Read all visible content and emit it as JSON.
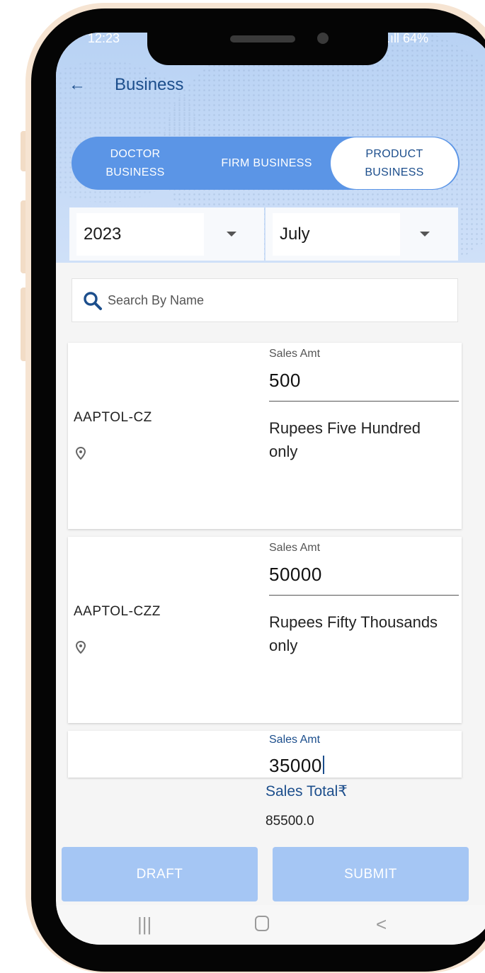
{
  "status": {
    "time": "12:23",
    "battery": "64%"
  },
  "header": {
    "title": "Business"
  },
  "tabs": [
    {
      "label": "DOCTOR\nBUSINESS",
      "active": false
    },
    {
      "label": "FIRM BUSINESS",
      "active": false
    },
    {
      "label": "PRODUCT\nBUSINESS",
      "active": true
    }
  ],
  "filters": {
    "year": "2023",
    "month": "July"
  },
  "search": {
    "placeholder": "Search By Name"
  },
  "items": [
    {
      "name": "AAPTOL-CZ",
      "amount_label": "Sales Amt",
      "amount": "500",
      "amount_words": "Rupees Five Hundred only"
    },
    {
      "name": "AAPTOL-CZZ",
      "amount_label": "Sales Amt",
      "amount": "50000",
      "amount_words": "Rupees Fifty Thousands   only"
    },
    {
      "name": "",
      "amount_label": "Sales Amt",
      "amount": "35000",
      "amount_words": ""
    }
  ],
  "totals": {
    "label": "Sales Total₹",
    "value": "85500.0"
  },
  "actions": {
    "draft": "DRAFT",
    "submit": "SUBMIT"
  },
  "colors": {
    "primary": "#1c4e8c",
    "segment": "#5b95e6",
    "button": "#a5c6f4",
    "header": "#c3d9f6"
  }
}
